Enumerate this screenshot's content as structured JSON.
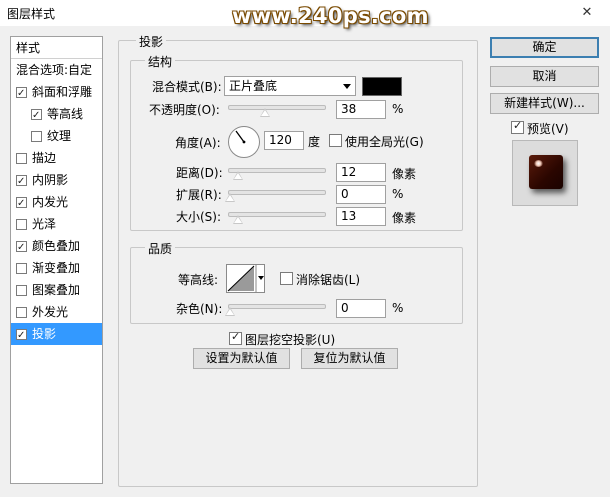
{
  "window": {
    "title": "图层样式",
    "watermark": "www.240ps.com",
    "close_glyph": "✕"
  },
  "sidebar": {
    "header": "样式",
    "items": [
      {
        "label": "混合选项:自定",
        "checkbox": false,
        "checked": false,
        "selected": false
      },
      {
        "label": "斜面和浮雕",
        "checkbox": true,
        "checked": true,
        "selected": false
      },
      {
        "label": "等高线",
        "checkbox": true,
        "checked": true,
        "selected": false
      },
      {
        "label": "纹理",
        "checkbox": true,
        "checked": false,
        "selected": false
      },
      {
        "label": "描边",
        "checkbox": true,
        "checked": false,
        "selected": false
      },
      {
        "label": "内阴影",
        "checkbox": true,
        "checked": true,
        "selected": false
      },
      {
        "label": "内发光",
        "checkbox": true,
        "checked": true,
        "selected": false
      },
      {
        "label": "光泽",
        "checkbox": true,
        "checked": false,
        "selected": false
      },
      {
        "label": "颜色叠加",
        "checkbox": true,
        "checked": true,
        "selected": false
      },
      {
        "label": "渐变叠加",
        "checkbox": true,
        "checked": false,
        "selected": false
      },
      {
        "label": "图案叠加",
        "checkbox": true,
        "checked": false,
        "selected": false
      },
      {
        "label": "外发光",
        "checkbox": true,
        "checked": false,
        "selected": false
      },
      {
        "label": "投影",
        "checkbox": true,
        "checked": true,
        "selected": true
      }
    ]
  },
  "panel": {
    "title": "投影",
    "structure": {
      "title": "结构",
      "blend_mode_label": "混合模式(B):",
      "blend_mode_value": "正片叠底",
      "shadow_color": "#000000",
      "opacity_label": "不透明度(O):",
      "opacity_value": "38",
      "opacity_unit": "%",
      "opacity_level": 0.38,
      "angle_label": "角度(A):",
      "angle_value": "120",
      "angle_unit": "度",
      "use_global_light_label": "使用全局光(G)",
      "use_global_light_checked": false,
      "distance_label": "距离(D):",
      "distance_value": "12",
      "distance_unit": "像素",
      "spread_label": "扩展(R):",
      "spread_value": "0",
      "spread_unit": "%",
      "size_label": "大小(S):",
      "size_value": "13",
      "size_unit": "像素"
    },
    "quality": {
      "title": "品质",
      "contour_label": "等高线:",
      "anti_alias_label": "消除锯齿(L)",
      "anti_alias_checked": false,
      "noise_label": "杂色(N):",
      "noise_value": "0",
      "noise_unit": "%"
    },
    "knockout_label": "图层挖空投影(U)",
    "knockout_checked": true,
    "make_default_label": "设置为默认值",
    "reset_default_label": "复位为默认值"
  },
  "actions": {
    "ok_label": "确定",
    "cancel_label": "取消",
    "new_style_label": "新建样式(W)...",
    "preview_label": "预览(V)",
    "preview_checked": true
  }
}
